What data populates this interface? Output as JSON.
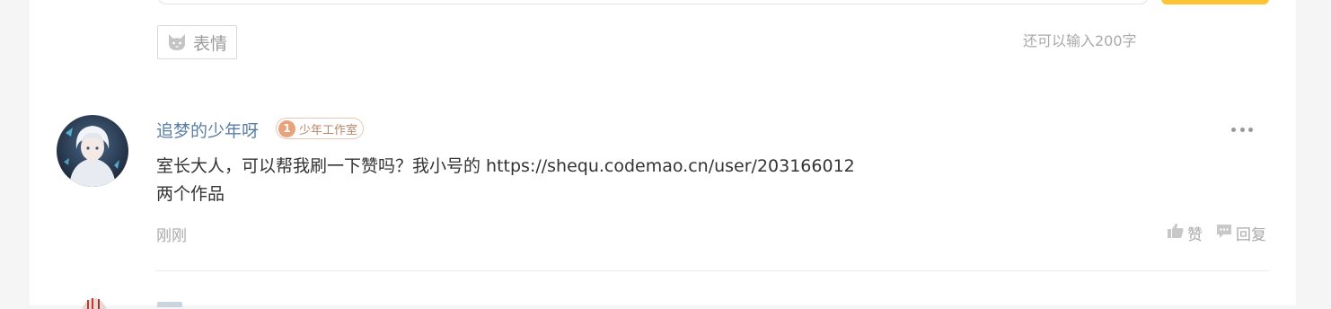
{
  "editor": {
    "emoji_label": "表情",
    "char_hint": "还可以输入200字"
  },
  "comment": {
    "username": "追梦的少年呀",
    "badge_level": "1",
    "badge_label": "少年工作室",
    "body_line1": "室长大人，可以帮我刷一下赞吗？我小号的 https://shequ.codemao.cn/user/203166012",
    "body_line2": "两个作品",
    "timestamp": "刚刚",
    "like_label": "赞",
    "reply_label": "回复"
  },
  "icons": {
    "emoji": "cat-face-icon",
    "more": "more-dots-icon",
    "like": "thumbs-up-icon",
    "reply": "comment-bubble-icon"
  },
  "colors": {
    "accent_yellow": "#fec433",
    "username": "#5a7fa6",
    "badge": "#e8a27c",
    "muted_text": "#a9a9a9"
  }
}
